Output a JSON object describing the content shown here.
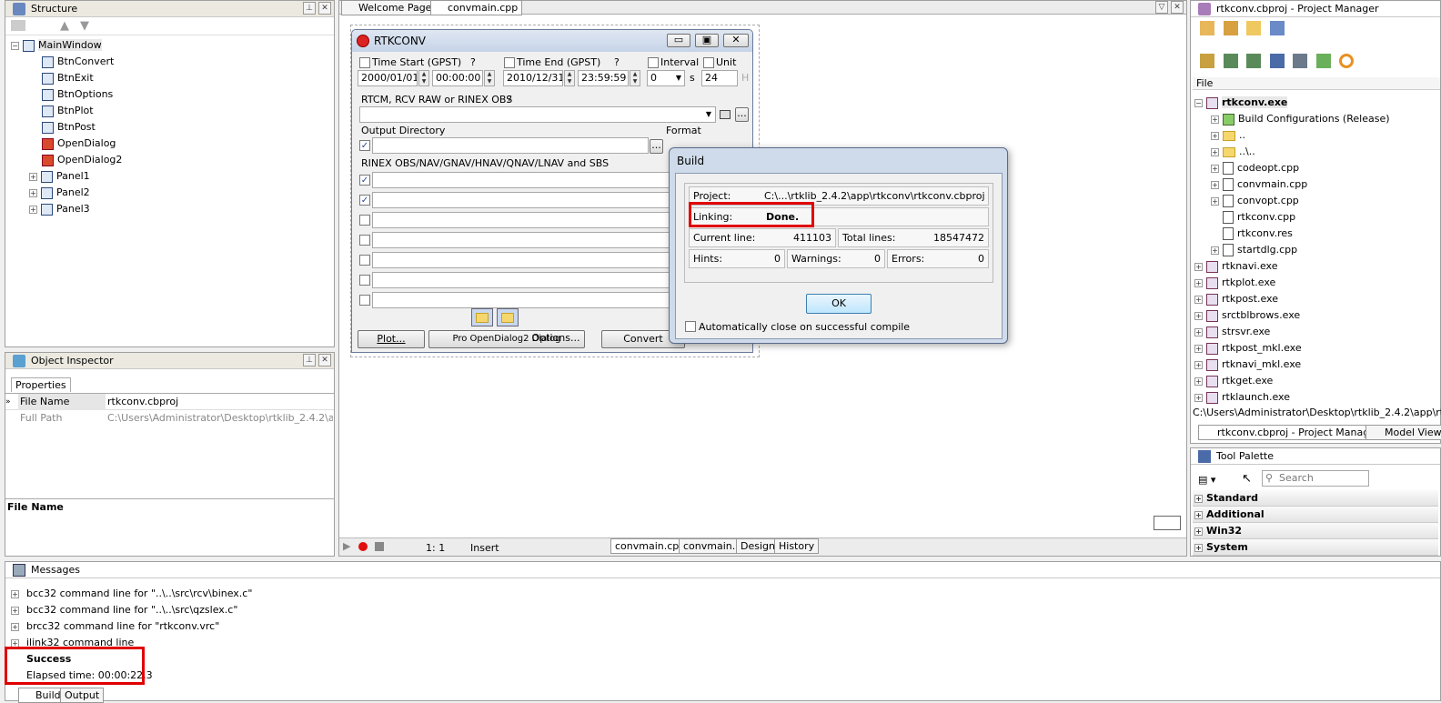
{
  "structure": {
    "title": "Structure",
    "root": "MainWindow",
    "items": [
      "BtnConvert",
      "BtnExit",
      "BtnOptions",
      "BtnPlot",
      "BtnPost",
      "OpenDialog",
      "OpenDialog2"
    ],
    "panels": [
      "Panel1",
      "Panel2",
      "Panel3"
    ]
  },
  "inspector": {
    "title": "Object Inspector",
    "tab": "Properties",
    "rows": [
      {
        "name": "File Name",
        "value": "rtkconv.cbproj"
      },
      {
        "name": "Full Path",
        "value": "C:\\Users\\Administrator\\Desktop\\rtklib_2.4.2\\app\\rtk"
      }
    ],
    "desc_title": "File Name"
  },
  "editor": {
    "tabs": [
      "Welcome Page",
      "convmain.cpp"
    ],
    "status": {
      "pos": "1:   1",
      "mode": "Insert"
    },
    "bottom_tabs": [
      "convmain.cpp",
      "convmain.h",
      "Design",
      "History"
    ]
  },
  "form": {
    "title": "RTKCONV",
    "time_start_label": "Time Start (GPST)",
    "time_end_label": "Time End (GPST)",
    "q": "?",
    "interval_label": "Interval",
    "unit_label": "Unit",
    "start_date": "2000/01/01",
    "start_time": "00:00:00",
    "end_date": "2010/12/31",
    "end_time": "23:59:59",
    "interval_value": "0",
    "interval_unit": "s",
    "unit_value": "24",
    "unit_suffix": "H",
    "input_label": "RTCM, RCV RAW or RINEX OBS",
    "output_dir_label": "Output Directory",
    "format_label": "Format",
    "rinex_label": "RINEX OBS/NAV/GNAV/HNAV/QNAV/LNAV and SBS",
    "dots": "...",
    "btn_plot": "Plot...",
    "btn_post_overlay": "Pro OpenDialog2 Dialog",
    "btn_options": "Options...",
    "btn_convert": "Convert",
    "rinex_checks": [
      true,
      true,
      false,
      false,
      false,
      false,
      false
    ]
  },
  "build": {
    "title": "Build",
    "project_label": "Project:",
    "project_value": "C:\\...\\rtklib_2.4.2\\app\\rtkconv\\rtkconv.cbproj",
    "linking_label": "Linking:",
    "linking_value": "Done.",
    "current_line_label": "Current line:",
    "current_line_value": "411103",
    "total_lines_label": "Total lines:",
    "total_lines_value": "18547472",
    "hints_label": "Hints:",
    "hints_value": "0",
    "warnings_label": "Warnings:",
    "warnings_value": "0",
    "errors_label": "Errors:",
    "errors_value": "0",
    "ok_label": "OK",
    "autoclose_label": "Automatically close on successful compile"
  },
  "project_manager": {
    "title": "rtkconv.cbproj - Project Manager",
    "file_header": "File",
    "root": "rtkconv.exe",
    "children": [
      "Build Configurations (Release)",
      "..",
      "..\\..",
      "codeopt.cpp",
      "convmain.cpp",
      "convopt.cpp",
      "rtkconv.cpp",
      "rtkconv.res",
      "startdlg.cpp"
    ],
    "siblings": [
      "rtknavi.exe",
      "rtkplot.exe",
      "rtkpost.exe",
      "srctblbrows.exe",
      "strsvr.exe",
      "rtkpost_mkl.exe",
      "rtknavi_mkl.exe",
      "rtkget.exe",
      "rtklaunch.exe"
    ],
    "path": "C:\\Users\\Administrator\\Desktop\\rtklib_2.4.2\\app\\rtkco",
    "tab1": "rtkconv.cbproj - Project Manager",
    "tab2": "Model View"
  },
  "palette": {
    "title": "Tool Palette",
    "search_placeholder": "Search",
    "categories": [
      "Standard",
      "Additional",
      "Win32",
      "System"
    ]
  },
  "messages": {
    "title": "Messages",
    "lines": [
      "bcc32 command line for \"..\\..\\src\\rcv\\binex.c\"",
      "bcc32 command line for \"..\\..\\src\\qzslex.c\"",
      "brcc32 command line for \"rtkconv.vrc\"",
      "ilink32 command line"
    ],
    "success": "Success",
    "elapsed": "Elapsed time: 00:00:22.3",
    "tabs": [
      "Build",
      "Output"
    ]
  }
}
